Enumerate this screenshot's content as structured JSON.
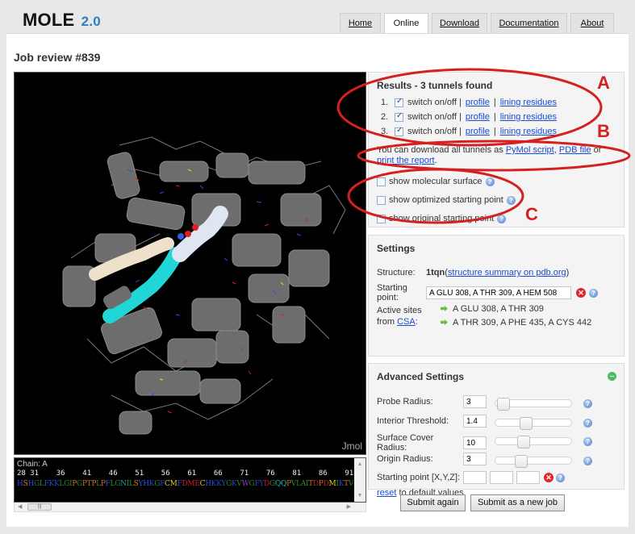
{
  "logo": {
    "name": "MOLE",
    "version": "2.0"
  },
  "nav": {
    "tabs": [
      {
        "label": "Home",
        "active": false
      },
      {
        "label": "Online",
        "active": true
      },
      {
        "label": "Download",
        "active": false
      },
      {
        "label": "Documentation",
        "active": false
      },
      {
        "label": "About",
        "active": false
      }
    ]
  },
  "page": {
    "title": "Job review #839"
  },
  "viewer": {
    "label": "Jmol",
    "sequence": {
      "chain": "Chain: A",
      "numbers": "28 31    36    41    46    51    56    61    66    71    76    81    86    91",
      "residues": [
        {
          "t": "H",
          "c": "#3050e0"
        },
        {
          "t": "S",
          "c": "#e08020"
        },
        {
          "t": "H",
          "c": "#3050e0"
        },
        {
          "t": "G",
          "c": "#2e7d32"
        },
        {
          "t": "L",
          "c": "#2e8b2e"
        },
        {
          "t": "F",
          "c": "#2a47c8"
        },
        {
          "t": "K",
          "c": "#2a47c8"
        },
        {
          "t": "K",
          "c": "#2a47c8"
        },
        {
          "t": "L",
          "c": "#2e8b2e"
        },
        {
          "t": "G",
          "c": "#2e8b2e"
        },
        {
          "t": "I",
          "c": "#2e8b2e"
        },
        {
          "t": "P",
          "c": "#d07020"
        },
        {
          "t": "G",
          "c": "#2e8b2e"
        },
        {
          "t": "P",
          "c": "#d07020"
        },
        {
          "t": "T",
          "c": "#d07020"
        },
        {
          "t": "P",
          "c": "#d07020"
        },
        {
          "t": "L",
          "c": "#2e8b2e"
        },
        {
          "t": "P",
          "c": "#d07020"
        },
        {
          "t": "F",
          "c": "#2a47c8"
        },
        {
          "t": "L",
          "c": "#2e8b2e"
        },
        {
          "t": "G",
          "c": "#2e8b2e"
        },
        {
          "t": "N",
          "c": "#20a0a0"
        },
        {
          "t": "I",
          "c": "#2e8b2e"
        },
        {
          "t": "L",
          "c": "#2e8b2e"
        },
        {
          "t": "S",
          "c": "#e08020"
        },
        {
          "t": "Y",
          "c": "#2a47c8"
        },
        {
          "t": "H",
          "c": "#3050e0"
        },
        {
          "t": "K",
          "c": "#2a47c8"
        },
        {
          "t": "G",
          "c": "#2e8b2e"
        },
        {
          "t": "F",
          "c": "#2a47c8"
        },
        {
          "t": "C",
          "c": "#e0d020"
        },
        {
          "t": "M",
          "c": "#e0d020"
        },
        {
          "t": "F",
          "c": "#2a47c8"
        },
        {
          "t": "D",
          "c": "#d02020"
        },
        {
          "t": "M",
          "c": "#d02020"
        },
        {
          "t": "E",
          "c": "#d02020"
        },
        {
          "t": "C",
          "c": "#e0d020"
        },
        {
          "t": "H",
          "c": "#3050e0"
        },
        {
          "t": "K",
          "c": "#2a47c8"
        },
        {
          "t": "K",
          "c": "#2a47c8"
        },
        {
          "t": "Y",
          "c": "#2a47c8"
        },
        {
          "t": "G",
          "c": "#2e8b2e"
        },
        {
          "t": "K",
          "c": "#2a47c8"
        },
        {
          "t": "V",
          "c": "#2e8b2e"
        },
        {
          "t": "W",
          "c": "#9040c0"
        },
        {
          "t": "G",
          "c": "#2e8b2e"
        },
        {
          "t": "F",
          "c": "#2a47c8"
        },
        {
          "t": "Y",
          "c": "#2a47c8"
        },
        {
          "t": "D",
          "c": "#d02020"
        },
        {
          "t": "G",
          "c": "#2e8b2e"
        },
        {
          "t": "Q",
          "c": "#20c0c0"
        },
        {
          "t": "Q",
          "c": "#20c0c0"
        },
        {
          "t": "P",
          "c": "#d07020"
        },
        {
          "t": "V",
          "c": "#2e8b2e"
        },
        {
          "t": "L",
          "c": "#2e8b2e"
        },
        {
          "t": "A",
          "c": "#2e8b2e"
        },
        {
          "t": "I",
          "c": "#2e8b2e"
        },
        {
          "t": "T",
          "c": "#d07020"
        },
        {
          "t": "D",
          "c": "#d02020"
        },
        {
          "t": "P",
          "c": "#d07020"
        },
        {
          "t": "D",
          "c": "#d02020"
        },
        {
          "t": "M",
          "c": "#e0d020"
        },
        {
          "t": "I",
          "c": "#2e8b2e"
        },
        {
          "t": "K",
          "c": "#2a47c8"
        },
        {
          "t": "T",
          "c": "#d07020"
        },
        {
          "t": "V",
          "c": "#2e8b2e"
        }
      ]
    }
  },
  "results": {
    "title": "Results - 3 tunnels found",
    "tunnels": [
      {
        "index": "1.",
        "checked": true,
        "switch_label": "switch on/off |",
        "profile": "profile",
        "sep": "|",
        "lining": "lining residues"
      },
      {
        "index": "2.",
        "checked": true,
        "switch_label": "switch on/off |",
        "profile": "profile",
        "sep": "|",
        "lining": "lining residues"
      },
      {
        "index": "3.",
        "checked": true,
        "switch_label": "switch on/off |",
        "profile": "profile",
        "sep": "|",
        "lining": "lining residues"
      }
    ],
    "download_prefix": "You can download all tunnels as ",
    "pymol_link": "PyMol script",
    "comma": ", ",
    "pdb_link": "PDB file",
    "or_text": " or ",
    "print_link": "print the report",
    "period": ".",
    "options": [
      {
        "label": "show molecular surface",
        "checked": false
      },
      {
        "label": "show optimized starting point",
        "checked": false
      },
      {
        "label": "show original starting point",
        "checked": false
      }
    ]
  },
  "settings": {
    "title": "Settings",
    "structure_label": "Structure:",
    "structure_id": "1tqn",
    "structure_link_open": " (",
    "structure_link": "structure summary on pdb.org",
    "structure_link_close": ")",
    "starting_point_label": "Starting point:",
    "starting_point_value": "A GLU 308, A THR 309, A HEM 508",
    "active_sites_label_1": "Active sites",
    "active_sites_label_2": "from ",
    "csa_link": "CSA",
    "colon": ":",
    "active_sites": [
      "A GLU 308, A THR 309",
      "A THR 309, A PHE 435, A CYS 442"
    ]
  },
  "advanced": {
    "title": "Advanced Settings",
    "params": [
      {
        "label": "Probe Radius:",
        "value": "3",
        "slider": 0.03
      },
      {
        "label": "Interior Threshold:",
        "value": "1.4",
        "slider": 0.38
      },
      {
        "label": "Surface Cover Radius:",
        "value": "10",
        "slider": 0.34
      },
      {
        "label": "Origin Radius:",
        "value": "3",
        "slider": 0.3
      }
    ],
    "xyz_label": "Starting point [X,Y,Z]:",
    "xyz_values": [
      "",
      "",
      ""
    ],
    "reset_link": "reset",
    "reset_suffix": " to default values"
  },
  "buttons": {
    "submit_again": "Submit again",
    "submit_new": "Submit as a new job"
  },
  "annotations": {
    "a": "A",
    "b": "B",
    "c": "C"
  }
}
